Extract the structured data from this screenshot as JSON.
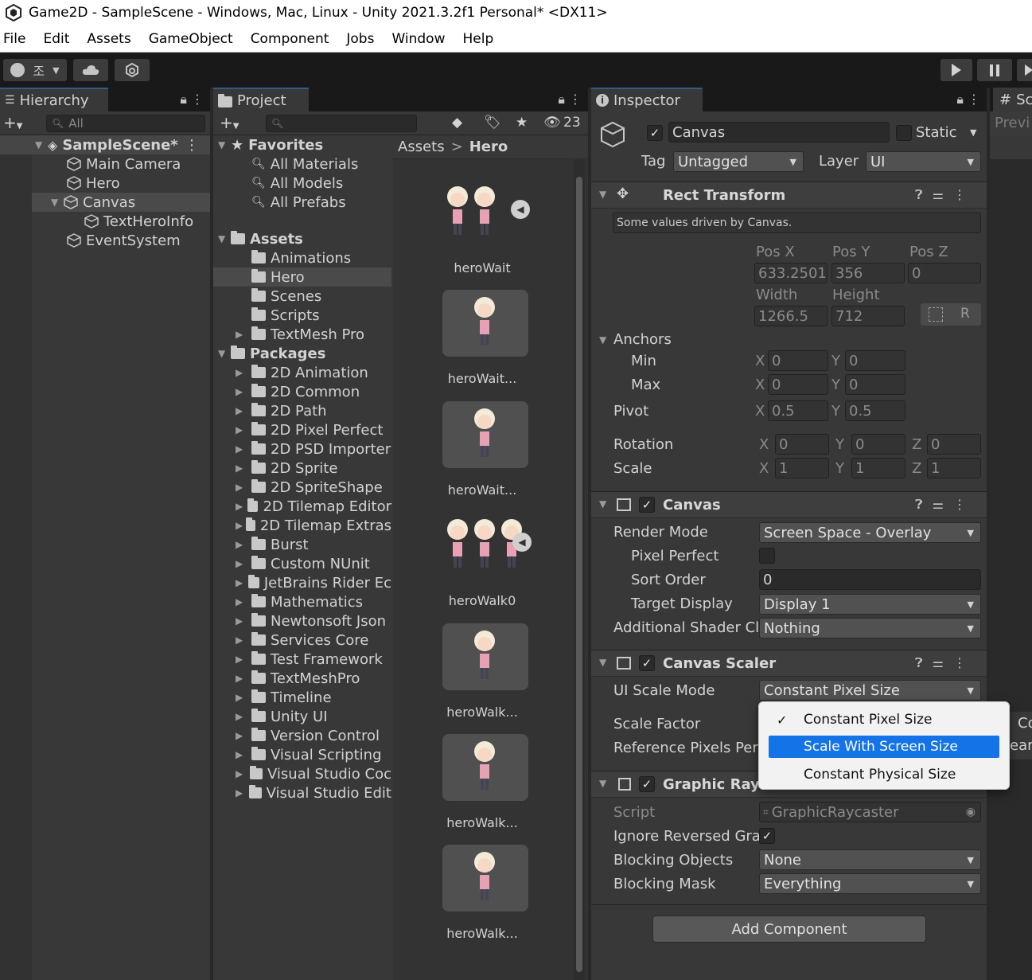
{
  "window": {
    "title": "Game2D - SampleScene - Windows, Mac, Linux - Unity 2021.3.2f1 Personal* <DX11>"
  },
  "menu": [
    "File",
    "Edit",
    "Assets",
    "GameObject",
    "Component",
    "Jobs",
    "Window",
    "Help"
  ],
  "toolbar": {
    "account_label": "조"
  },
  "hierarchy": {
    "tab": "Hierarchy",
    "search_placeholder": "All",
    "items": [
      {
        "label": "SampleScene*"
      },
      {
        "label": "Main Camera"
      },
      {
        "label": "Hero"
      },
      {
        "label": "Canvas"
      },
      {
        "label": "TextHeroInfo"
      },
      {
        "label": "EventSystem"
      }
    ]
  },
  "project": {
    "tab": "Project",
    "hidden_count": "23",
    "breadcrumb": {
      "root": "Assets",
      "sep": ">",
      "current": "Hero"
    },
    "favorites": {
      "label": "Favorites",
      "items": [
        "All Materials",
        "All Models",
        "All Prefabs"
      ]
    },
    "assets": {
      "label": "Assets",
      "items": [
        "Animations",
        "Hero",
        "Scenes",
        "Scripts",
        "TextMesh Pro"
      ]
    },
    "packages": {
      "label": "Packages",
      "items": [
        "2D Animation",
        "2D Common",
        "2D Path",
        "2D Pixel Perfect",
        "2D PSD Importer",
        "2D Sprite",
        "2D SpriteShape",
        "2D Tilemap Editor",
        "2D Tilemap Extras",
        "Burst",
        "Custom NUnit",
        "JetBrains Rider Ec",
        "Mathematics",
        "Newtonsoft Json",
        "Services Core",
        "Test Framework",
        "TextMeshPro",
        "Timeline",
        "Unity UI",
        "Version Control",
        "Visual Scripting",
        "Visual Studio Coc",
        "Visual Studio Edit"
      ]
    },
    "assets_grid": [
      "heroWait",
      "heroWait...",
      "heroWait...",
      "heroWalk0",
      "heroWalk...",
      "heroWalk...",
      "heroWalk..."
    ]
  },
  "inspector": {
    "tab": "Inspector",
    "object_name": "Canvas",
    "static_label": "Static",
    "tag_label": "Tag",
    "tag_value": "Untagged",
    "layer_label": "Layer",
    "layer_value": "UI",
    "rect_transform": {
      "title": "Rect Transform",
      "note": "Some values driven by Canvas.",
      "pos_x_label": "Pos X",
      "pos_y_label": "Pos Y",
      "pos_z_label": "Pos Z",
      "pos_x": "633.2501",
      "pos_y": "356",
      "pos_z": "0",
      "width_label": "Width",
      "height_label": "Height",
      "width": "1266.5",
      "height": "712",
      "r_button": "R",
      "anchors_label": "Anchors",
      "min_label": "Min",
      "max_label": "Max",
      "min_x": "0",
      "min_y": "0",
      "max_x": "0",
      "max_y": "0",
      "pivot_label": "Pivot",
      "pivot_x": "0.5",
      "pivot_y": "0.5",
      "rotation_label": "Rotation",
      "rot_x": "0",
      "rot_y": "0",
      "rot_z": "0",
      "scale_label": "Scale",
      "scale_x": "1",
      "scale_y": "1",
      "scale_z": "1",
      "x": "X",
      "y": "Y",
      "z": "Z"
    },
    "canvas": {
      "title": "Canvas",
      "render_mode_label": "Render Mode",
      "render_mode": "Screen Space - Overlay",
      "pixel_perfect_label": "Pixel Perfect",
      "sort_order_label": "Sort Order",
      "sort_order": "0",
      "target_display_label": "Target Display",
      "target_display": "Display 1",
      "shader_label": "Additional Shader Cl",
      "shader_value": "Nothing"
    },
    "canvas_scaler": {
      "title": "Canvas Scaler",
      "ui_scale_mode_label": "UI Scale Mode",
      "ui_scale_mode": "Constant Pixel Size",
      "scale_factor_label": "Scale Factor",
      "ref_pixels_label": "Reference Pixels Per"
    },
    "graphic_raycaster": {
      "title": "Graphic Rayc",
      "script_label": "Script",
      "script_value": "GraphicRaycaster",
      "ignore_label": "Ignore Reversed Gra",
      "blocking_objects_label": "Blocking Objects",
      "blocking_objects": "None",
      "blocking_mask_label": "Blocking Mask",
      "blocking_mask": "Everything"
    },
    "add_component": "Add Component"
  },
  "scale_mode_popup": {
    "options": [
      "Constant Pixel Size",
      "Scale With Screen Size",
      "Constant Physical Size"
    ],
    "checked": "Constant Pixel Size",
    "highlighted": "Scale With Screen Size"
  },
  "right_panel": {
    "tab_prefix": "Sc",
    "preview_label": "Previ",
    "frag1": "Co",
    "frag2": "ear"
  }
}
